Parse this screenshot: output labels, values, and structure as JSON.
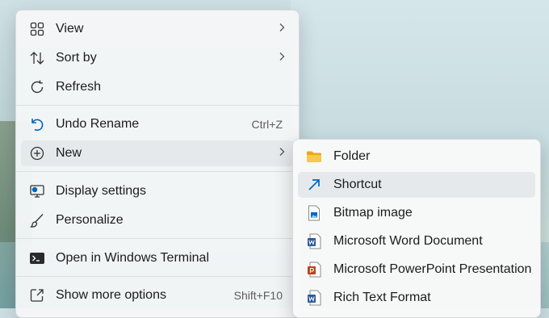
{
  "context_menu": {
    "items": [
      {
        "label": "View",
        "icon": "grid-icon"
      },
      {
        "label": "Sort by",
        "icon": "sort-arrows-icon"
      },
      {
        "label": "Refresh",
        "icon": "refresh-icon"
      },
      {
        "label": "Undo Rename",
        "icon": "undo-icon",
        "shortcut": "Ctrl+Z"
      },
      {
        "label": "New",
        "icon": "plus-circle-icon"
      },
      {
        "label": "Display settings",
        "icon": "monitor-settings-icon"
      },
      {
        "label": "Personalize",
        "icon": "brush-icon"
      },
      {
        "label": "Open in Windows Terminal",
        "icon": "terminal-icon"
      },
      {
        "label": "Show more options",
        "icon": "share-box-icon",
        "shortcut": "Shift+F10"
      }
    ]
  },
  "new_submenu": {
    "items": [
      {
        "label": "Folder",
        "icon": "folder-icon"
      },
      {
        "label": "Shortcut",
        "icon": "shortcut-arrow-icon"
      },
      {
        "label": "Bitmap image",
        "icon": "bitmap-file-icon"
      },
      {
        "label": "Microsoft Word Document",
        "icon": "word-file-icon"
      },
      {
        "label": "Microsoft PowerPoint Presentation",
        "icon": "powerpoint-file-icon"
      },
      {
        "label": "Rich Text Format",
        "icon": "rtf-file-icon"
      }
    ]
  },
  "colors": {
    "accent": "#0067c0",
    "word": "#2b579a",
    "powerpoint": "#c43e1c",
    "folder": "#f4c542"
  }
}
